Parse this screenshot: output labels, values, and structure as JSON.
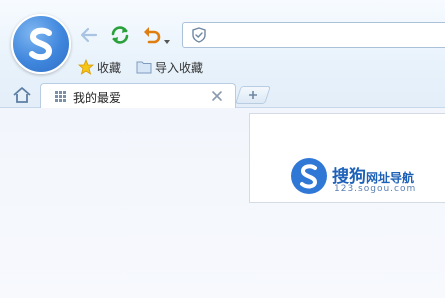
{
  "toolbar": {
    "address_value": "",
    "address_placeholder": ""
  },
  "bookmarks": [
    {
      "label": "收藏",
      "icon": "star-icon"
    },
    {
      "label": "导入收藏",
      "icon": "folder-icon"
    }
  ],
  "tabs": [
    {
      "label": "我的最爱",
      "icon": "grid-icon",
      "active": true
    }
  ],
  "content": {
    "site_name_main": "搜狗",
    "site_name_sub": "网址导航",
    "site_url": "123.sogou.com"
  },
  "colors": {
    "brand_blue": "#3f86dd",
    "refresh_green": "#2aa13a",
    "undo_orange": "#e07f10"
  }
}
